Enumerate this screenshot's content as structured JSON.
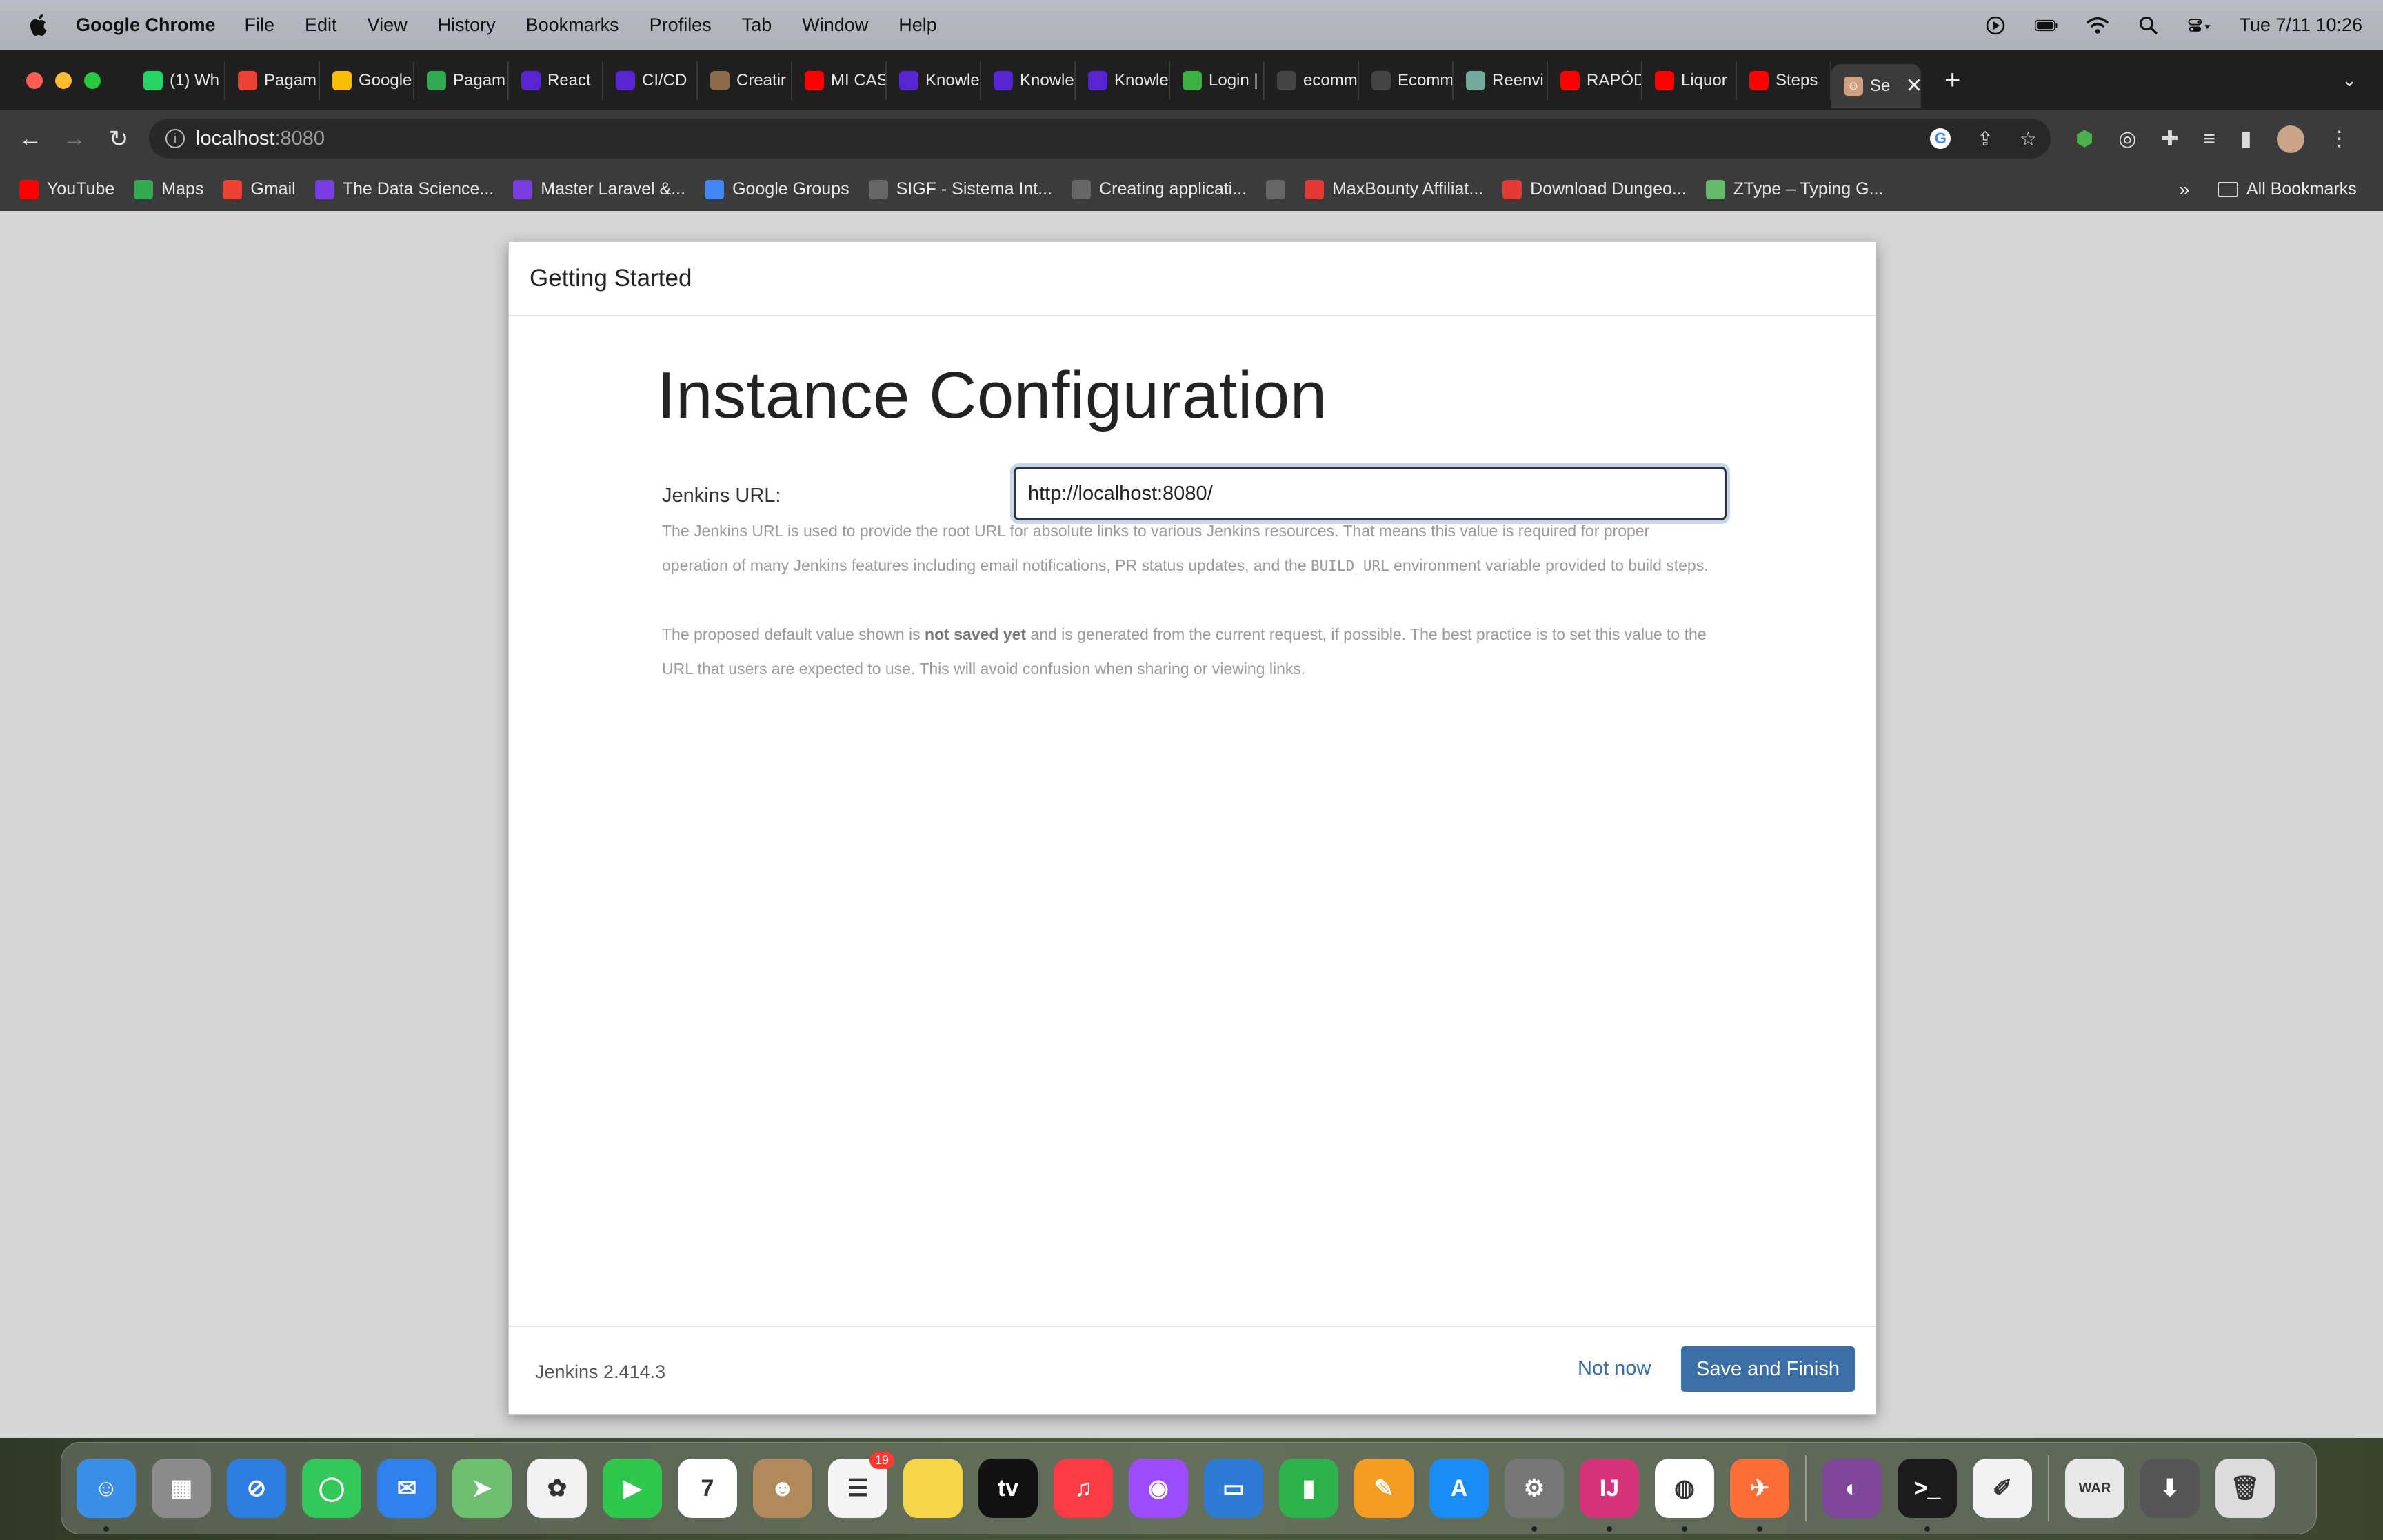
{
  "menubar": {
    "app_name": "Google Chrome",
    "items": [
      "File",
      "Edit",
      "View",
      "History",
      "Bookmarks",
      "Profiles",
      "Tab",
      "Window",
      "Help"
    ],
    "clock": "Tue 7/11  10:26"
  },
  "tabs": [
    {
      "label": "(1) Wh",
      "favicon": "whatsapp-icon",
      "color": "#25d366"
    },
    {
      "label": "Pagam",
      "favicon": "gmail-icon",
      "color": "#ea4335"
    },
    {
      "label": "Google",
      "favicon": "google-icon",
      "color": "#fbbc05"
    },
    {
      "label": "Pagam",
      "favicon": "sheets-icon",
      "color": "#34a853"
    },
    {
      "label": "React",
      "favicon": "udemy-icon",
      "color": "#5624d0"
    },
    {
      "label": "CI/CD",
      "favicon": "udemy-icon",
      "color": "#5624d0"
    },
    {
      "label": "Creatir",
      "favicon": "avatar-icon",
      "color": "#8b6b4a"
    },
    {
      "label": "MI CAS",
      "favicon": "youtube-icon",
      "color": "#ff0000"
    },
    {
      "label": "Knowle",
      "favicon": "udemy-icon",
      "color": "#5624d0"
    },
    {
      "label": "Knowle",
      "favicon": "udemy-icon",
      "color": "#5624d0"
    },
    {
      "label": "Knowle",
      "favicon": "udemy-icon",
      "color": "#5624d0"
    },
    {
      "label": "Login |",
      "favicon": "terminal-icon",
      "color": "#3cb043"
    },
    {
      "label": "ecomm",
      "favicon": "github-icon",
      "color": "#444444"
    },
    {
      "label": "Ecomm",
      "favicon": "github-icon",
      "color": "#444444"
    },
    {
      "label": "Reenvi",
      "favicon": "chatgpt-icon",
      "color": "#74aa9c"
    },
    {
      "label": "RAPÓD",
      "favicon": "youtube-icon",
      "color": "#ff0000"
    },
    {
      "label": "Liquor",
      "favicon": "youtube-icon",
      "color": "#ff0000"
    },
    {
      "label": "Steps",
      "favicon": "youtube-icon",
      "color": "#ff0000"
    }
  ],
  "active_tab": {
    "label": "Se",
    "favicon": "jenkins-icon",
    "color": "#d0a080"
  },
  "toolbar": {
    "host": "localhost",
    "port": ":8080"
  },
  "bookmarks": [
    {
      "label": "YouTube",
      "favicon": "youtube-icon",
      "color": "#ff0000"
    },
    {
      "label": "Maps",
      "favicon": "maps-icon",
      "color": "#34a853"
    },
    {
      "label": "Gmail",
      "favicon": "gmail-icon",
      "color": "#ea4335"
    },
    {
      "label": "The Data Science...",
      "favicon": "udemy-icon",
      "color": "#7a3ee0"
    },
    {
      "label": "Master Laravel &...",
      "favicon": "udemy-icon",
      "color": "#7a3ee0"
    },
    {
      "label": "Google Groups",
      "favicon": "groups-icon",
      "color": "#4285f4"
    },
    {
      "label": "SIGF - Sistema Int...",
      "favicon": "globe-icon",
      "color": "#666666"
    },
    {
      "label": "Creating applicati...",
      "favicon": "globe-icon",
      "color": "#666666"
    },
    {
      "label": "",
      "favicon": "globe-icon",
      "color": "#666666"
    },
    {
      "label": "MaxBounty Affiliat...",
      "favicon": "maxbounty-icon",
      "color": "#e53935"
    },
    {
      "label": "Download Dungeo...",
      "favicon": "ka-icon",
      "color": "#e53935"
    },
    {
      "label": "ZType – Typing G...",
      "favicon": "ztype-icon",
      "color": "#66bb6a"
    }
  ],
  "bookmarks_overflow": "»",
  "all_bookmarks": "All Bookmarks",
  "modal": {
    "header": "Getting Started",
    "heading": "Instance Configuration",
    "url_label": "Jenkins URL:",
    "url_value": "http://localhost:8080/",
    "help1_pre": "The Jenkins URL is used to provide the root URL for absolute links to various Jenkins resources. That means this value is required for proper operation of many Jenkins features including email notifications, PR status updates, and the ",
    "help1_code": "BUILD_URL",
    "help1_post": " environment variable provided to build steps.",
    "help2_pre": "The proposed default value shown is ",
    "help2_bold": "not saved yet",
    "help2_post": " and is generated from the current request, if possible. The best practice is to set this value to the URL that users are expected to use. This will avoid confusion when sharing or viewing links.",
    "version": "Jenkins 2.414.3",
    "not_now": "Not now",
    "save_finish": "Save and Finish"
  },
  "dock": [
    {
      "name": "finder-icon",
      "color": "#3a8ee6",
      "glyph": "☺",
      "running": true
    },
    {
      "name": "launchpad-icon",
      "color": "#8c8c8c",
      "glyph": "▦",
      "running": false
    },
    {
      "name": "safari-icon",
      "color": "#2f7de1",
      "glyph": "⊘",
      "running": false
    },
    {
      "name": "messages-icon",
      "color": "#34c759",
      "glyph": "◯",
      "running": false
    },
    {
      "name": "mail-icon",
      "color": "#2f80ed",
      "glyph": "✉",
      "running": false
    },
    {
      "name": "maps-icon",
      "color": "#6fbf73",
      "glyph": "➤",
      "running": false
    },
    {
      "name": "photos-icon",
      "color": "#f2f2f2",
      "glyph": "✿",
      "running": false
    },
    {
      "name": "facetime-icon",
      "color": "#30c74f",
      "glyph": "▶",
      "running": false
    },
    {
      "name": "calendar-icon",
      "color": "#ffffff",
      "glyph": "7",
      "running": false
    },
    {
      "name": "contacts-icon",
      "color": "#b08a5a",
      "glyph": "☻",
      "running": false
    },
    {
      "name": "reminders-icon",
      "color": "#f5f5f5",
      "glyph": "☰",
      "running": false,
      "badge": "19"
    },
    {
      "name": "notes-icon",
      "color": "#f7d54a",
      "glyph": "",
      "running": false
    },
    {
      "name": "appletv-icon",
      "color": "#111111",
      "glyph": "tv",
      "running": false
    },
    {
      "name": "music-icon",
      "color": "#fc3c44",
      "glyph": "♫",
      "running": false
    },
    {
      "name": "podcasts-icon",
      "color": "#9b4dff",
      "glyph": "◉",
      "running": false
    },
    {
      "name": "keynote-icon",
      "color": "#2e7bd6",
      "glyph": "▭",
      "running": false
    },
    {
      "name": "numbers-icon",
      "color": "#2fb24c",
      "glyph": "▮",
      "running": false
    },
    {
      "name": "pages-icon",
      "color": "#f59c23",
      "glyph": "✎",
      "running": false
    },
    {
      "name": "appstore-icon",
      "color": "#1a8cf5",
      "glyph": "A",
      "running": false
    },
    {
      "name": "system-settings-icon",
      "color": "#777777",
      "glyph": "⚙",
      "running": true
    },
    {
      "name": "intellij-icon",
      "color": "#d6337a",
      "glyph": "IJ",
      "running": true
    },
    {
      "name": "chrome-icon",
      "color": "#ffffff",
      "glyph": "◍",
      "running": true
    },
    {
      "name": "postman-icon",
      "color": "#ff6c37",
      "glyph": "✈",
      "running": true
    },
    {
      "name": "tor-icon",
      "color": "#7d4698",
      "glyph": "◐",
      "running": false,
      "sep_before": true
    },
    {
      "name": "terminal-icon",
      "color": "#1a1a1a",
      "glyph": ">_",
      "running": true
    },
    {
      "name": "textedit-icon",
      "color": "#f2f2f2",
      "glyph": "✐",
      "running": false
    },
    {
      "name": "war-file-icon",
      "color": "#e8e8e8",
      "glyph": "WAR",
      "running": false,
      "sep_before": true
    },
    {
      "name": "downloads-icon",
      "color": "#555555",
      "glyph": "⬇",
      "running": false
    },
    {
      "name": "trash-icon",
      "color": "#dcdcdc",
      "glyph": "🗑",
      "running": false
    }
  ]
}
